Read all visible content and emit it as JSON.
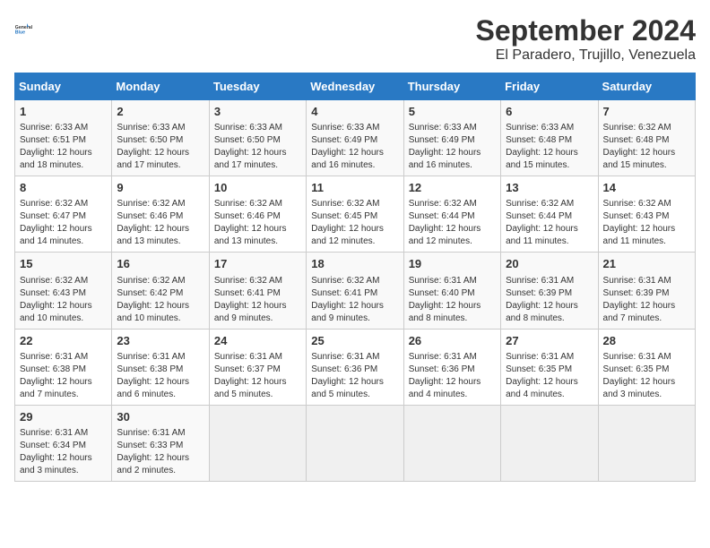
{
  "header": {
    "logo_line1": "General",
    "logo_line2": "Blue",
    "title": "September 2024",
    "subtitle": "El Paradero, Trujillo, Venezuela"
  },
  "days_of_week": [
    "Sunday",
    "Monday",
    "Tuesday",
    "Wednesday",
    "Thursday",
    "Friday",
    "Saturday"
  ],
  "weeks": [
    [
      {
        "day": "1",
        "info": "Sunrise: 6:33 AM\nSunset: 6:51 PM\nDaylight: 12 hours\nand 18 minutes."
      },
      {
        "day": "2",
        "info": "Sunrise: 6:33 AM\nSunset: 6:50 PM\nDaylight: 12 hours\nand 17 minutes."
      },
      {
        "day": "3",
        "info": "Sunrise: 6:33 AM\nSunset: 6:50 PM\nDaylight: 12 hours\nand 17 minutes."
      },
      {
        "day": "4",
        "info": "Sunrise: 6:33 AM\nSunset: 6:49 PM\nDaylight: 12 hours\nand 16 minutes."
      },
      {
        "day": "5",
        "info": "Sunrise: 6:33 AM\nSunset: 6:49 PM\nDaylight: 12 hours\nand 16 minutes."
      },
      {
        "day": "6",
        "info": "Sunrise: 6:33 AM\nSunset: 6:48 PM\nDaylight: 12 hours\nand 15 minutes."
      },
      {
        "day": "7",
        "info": "Sunrise: 6:32 AM\nSunset: 6:48 PM\nDaylight: 12 hours\nand 15 minutes."
      }
    ],
    [
      {
        "day": "8",
        "info": "Sunrise: 6:32 AM\nSunset: 6:47 PM\nDaylight: 12 hours\nand 14 minutes."
      },
      {
        "day": "9",
        "info": "Sunrise: 6:32 AM\nSunset: 6:46 PM\nDaylight: 12 hours\nand 13 minutes."
      },
      {
        "day": "10",
        "info": "Sunrise: 6:32 AM\nSunset: 6:46 PM\nDaylight: 12 hours\nand 13 minutes."
      },
      {
        "day": "11",
        "info": "Sunrise: 6:32 AM\nSunset: 6:45 PM\nDaylight: 12 hours\nand 12 minutes."
      },
      {
        "day": "12",
        "info": "Sunrise: 6:32 AM\nSunset: 6:44 PM\nDaylight: 12 hours\nand 12 minutes."
      },
      {
        "day": "13",
        "info": "Sunrise: 6:32 AM\nSunset: 6:44 PM\nDaylight: 12 hours\nand 11 minutes."
      },
      {
        "day": "14",
        "info": "Sunrise: 6:32 AM\nSunset: 6:43 PM\nDaylight: 12 hours\nand 11 minutes."
      }
    ],
    [
      {
        "day": "15",
        "info": "Sunrise: 6:32 AM\nSunset: 6:43 PM\nDaylight: 12 hours\nand 10 minutes."
      },
      {
        "day": "16",
        "info": "Sunrise: 6:32 AM\nSunset: 6:42 PM\nDaylight: 12 hours\nand 10 minutes."
      },
      {
        "day": "17",
        "info": "Sunrise: 6:32 AM\nSunset: 6:41 PM\nDaylight: 12 hours\nand 9 minutes."
      },
      {
        "day": "18",
        "info": "Sunrise: 6:32 AM\nSunset: 6:41 PM\nDaylight: 12 hours\nand 9 minutes."
      },
      {
        "day": "19",
        "info": "Sunrise: 6:31 AM\nSunset: 6:40 PM\nDaylight: 12 hours\nand 8 minutes."
      },
      {
        "day": "20",
        "info": "Sunrise: 6:31 AM\nSunset: 6:39 PM\nDaylight: 12 hours\nand 8 minutes."
      },
      {
        "day": "21",
        "info": "Sunrise: 6:31 AM\nSunset: 6:39 PM\nDaylight: 12 hours\nand 7 minutes."
      }
    ],
    [
      {
        "day": "22",
        "info": "Sunrise: 6:31 AM\nSunset: 6:38 PM\nDaylight: 12 hours\nand 7 minutes."
      },
      {
        "day": "23",
        "info": "Sunrise: 6:31 AM\nSunset: 6:38 PM\nDaylight: 12 hours\nand 6 minutes."
      },
      {
        "day": "24",
        "info": "Sunrise: 6:31 AM\nSunset: 6:37 PM\nDaylight: 12 hours\nand 5 minutes."
      },
      {
        "day": "25",
        "info": "Sunrise: 6:31 AM\nSunset: 6:36 PM\nDaylight: 12 hours\nand 5 minutes."
      },
      {
        "day": "26",
        "info": "Sunrise: 6:31 AM\nSunset: 6:36 PM\nDaylight: 12 hours\nand 4 minutes."
      },
      {
        "day": "27",
        "info": "Sunrise: 6:31 AM\nSunset: 6:35 PM\nDaylight: 12 hours\nand 4 minutes."
      },
      {
        "day": "28",
        "info": "Sunrise: 6:31 AM\nSunset: 6:35 PM\nDaylight: 12 hours\nand 3 minutes."
      }
    ],
    [
      {
        "day": "29",
        "info": "Sunrise: 6:31 AM\nSunset: 6:34 PM\nDaylight: 12 hours\nand 3 minutes."
      },
      {
        "day": "30",
        "info": "Sunrise: 6:31 AM\nSunset: 6:33 PM\nDaylight: 12 hours\nand 2 minutes."
      },
      {
        "day": "",
        "info": ""
      },
      {
        "day": "",
        "info": ""
      },
      {
        "day": "",
        "info": ""
      },
      {
        "day": "",
        "info": ""
      },
      {
        "day": "",
        "info": ""
      }
    ]
  ]
}
